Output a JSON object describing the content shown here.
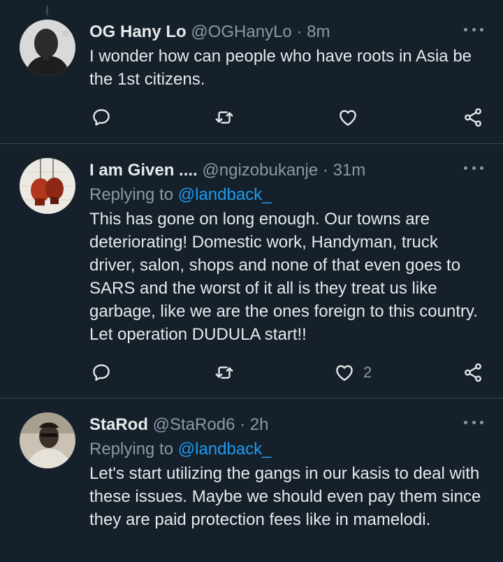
{
  "tweets": [
    {
      "name": "OG Hany Lo",
      "handle": "@OGHanyLo",
      "sep": "·",
      "time": "8m",
      "replying_label": "",
      "replying_mention": "",
      "text": "I wonder how can people who have roots in Asia be the 1st citizens.",
      "like_count": "",
      "avatar_colors": [
        "#d9d9d9",
        "#2b2b2b"
      ]
    },
    {
      "name": "I am Given ....",
      "handle": "@ngizobukanje",
      "sep": "·",
      "time": "31m",
      "replying_label": "Replying to",
      "replying_mention": "@landback_",
      "text": "This has gone on long enough. Our towns are deteriorating! Domestic work, Handyman, truck driver, salon, shops and none of that even goes to SARS and the worst of it all is they treat us like garbage, like we are the ones foreign to this country. Let operation DUDULA start!!",
      "like_count": "2",
      "avatar_colors": [
        "#ece8e2",
        "#b2361e"
      ]
    },
    {
      "name": "StaRod",
      "handle": "@StaRod6",
      "sep": "·",
      "time": "2h",
      "replying_label": "Replying to",
      "replying_mention": "@landback_",
      "text": "Let's start utilizing the gangs in our kasis to deal with these issues. Maybe we should even pay them since they are paid protection fees like in mamelodi.",
      "like_count": "",
      "avatar_colors": [
        "#c9c2b5",
        "#3d3128"
      ]
    }
  ],
  "icons": {
    "reply": "reply-icon",
    "retweet": "retweet-icon",
    "like": "like-icon",
    "share": "share-icon",
    "more": "more-icon"
  },
  "colors": {
    "background": "#15202b",
    "text": "#e7e9ea",
    "secondary": "#8b98a5",
    "accent": "#1d9bf0",
    "divider": "#38444d"
  }
}
